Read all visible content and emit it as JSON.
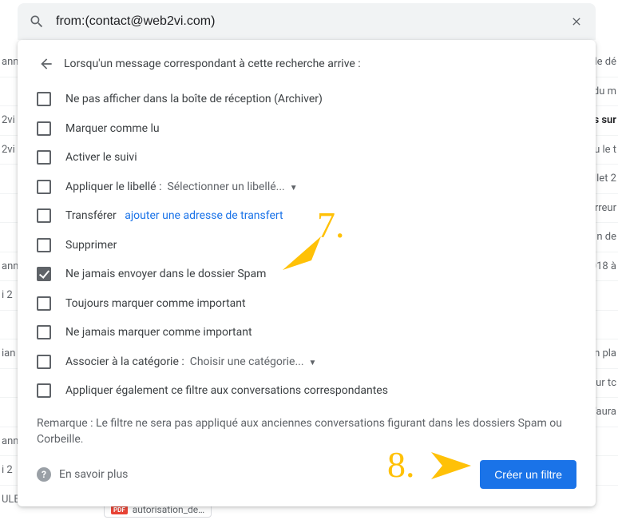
{
  "search": {
    "value": "from:(contact@web2vi.com)",
    "placeholder": ""
  },
  "panel": {
    "heading": "Lorsqu'un message correspondant à cette recherche arrive :",
    "options": {
      "archive": "Ne pas afficher dans la boîte de réception (Archiver)",
      "mark_read": "Marquer comme lu",
      "star": "Activer le suivi",
      "apply_label_prefix": "Appliquer le libellé :",
      "apply_label_select": "Sélectionner un libellé...",
      "forward_prefix": "Transférer",
      "forward_link": "ajouter une adresse de transfert",
      "delete": "Supprimer",
      "never_spam": "Ne jamais envoyer dans le dossier Spam",
      "always_important": "Toujours marquer comme important",
      "never_important": "Ne jamais marquer comme important",
      "category_prefix": "Associer à la catégorie :",
      "category_select": "Choisir une catégorie...",
      "also_apply": "Appliquer également ce filtre aux conversations correspondantes"
    },
    "note": "Remarque : Le filtre ne sera pas appliqué aux anciennes conversations figurant dans les dossiers Spam ou Corbeille.",
    "learn_more": "En savoir plus",
    "create_button": "Créer un filtre"
  },
  "annotations": {
    "n7": "7.",
    "n8": "8."
  },
  "background": {
    "left": [
      "ann",
      "",
      "2vi",
      "2vi",
      "",
      "",
      "",
      "ann",
      "i 2",
      "",
      "ian",
      "",
      "",
      "ann",
      "i 2",
      "",
      "ULE"
    ],
    "right": [
      "le dé",
      "du m",
      "s sur",
      "u le t",
      "illet 2",
      "rreur",
      "n de",
      "018 à",
      "",
      "",
      "n pla",
      "ur tc",
      "l'aura",
      ""
    ],
    "attachment": "autorisation_de…"
  }
}
